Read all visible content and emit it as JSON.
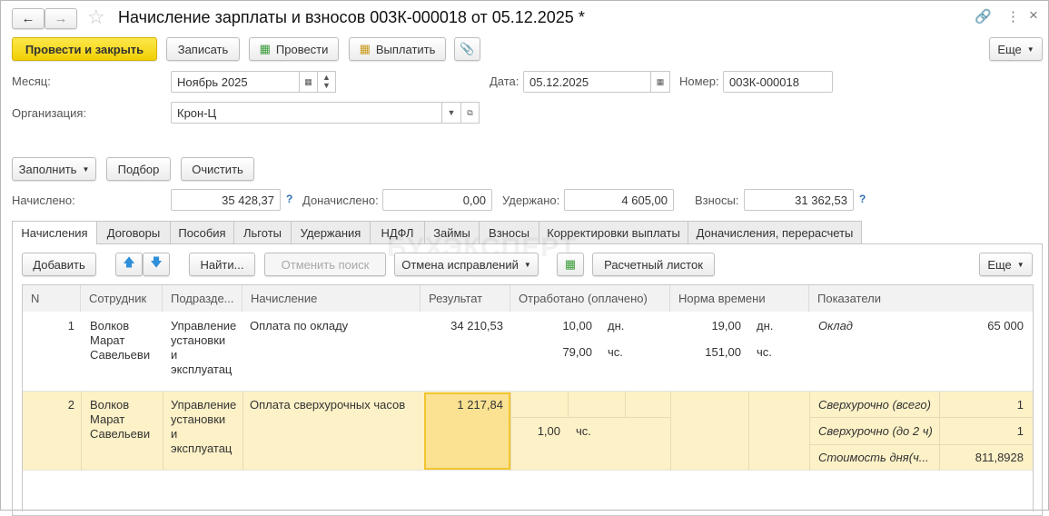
{
  "window": {
    "title": "Начисление зарплаты и взносов 003К-000018 от 05.12.2025 *",
    "icons": [
      "back-arrow-icon",
      "forward-arrow-icon",
      "star-icon",
      "link-icon",
      "more-icon",
      "close-icon"
    ]
  },
  "toolbar": {
    "post_close": "Провести и закрыть",
    "save": "Записать",
    "post": "Провести",
    "pay": "Выплатить",
    "more": "Еще"
  },
  "form": {
    "month_label": "Месяц:",
    "month_value": "Ноябрь 2025",
    "date_label": "Дата:",
    "date_value": "05.12.2025",
    "number_label": "Номер:",
    "number_value": "003К-000018",
    "org_label": "Организация:",
    "org_value": "Крон-Ц"
  },
  "actions": {
    "fill": "Заполнить",
    "select": "Подбор",
    "clear": "Очистить"
  },
  "totals": {
    "accrued_label": "Начислено:",
    "accrued": "35 428,37",
    "extra_label": "Доначислено:",
    "extra": "0,00",
    "withheld_label": "Удержано:",
    "withheld": "4 605,00",
    "contrib_label": "Взносы:",
    "contrib": "31 362,53",
    "help": "?"
  },
  "tabs": [
    "Начисления",
    "Договоры",
    "Пособия",
    "Льготы",
    "Удержания",
    "НДФЛ",
    "Займы",
    "Взносы",
    "Корректировки выплаты",
    "Доначисления, перерасчеты"
  ],
  "watermark": "БУХЭКСПЕРТ",
  "table_toolbar": {
    "add": "Добавить",
    "find": "Найти...",
    "cancel_search": "Отменить поиск",
    "cancel_corrections": "Отмена исправлений",
    "payslip": "Расчетный листок",
    "more": "Еще"
  },
  "table": {
    "columns": [
      "N",
      "Сотрудник",
      "Подразде...",
      "Начисление",
      "Результат",
      "Отработано (оплачено)",
      "Норма времени",
      "Показатели"
    ],
    "rows": [
      {
        "n": "1",
        "employee": [
          "Волков",
          "Марат",
          "Савельеви"
        ],
        "dept": [
          "Управление",
          "установки",
          "и",
          "эксплуатац"
        ],
        "accrual": "Оплата по окладу",
        "result": "34 210,53",
        "worked": [
          {
            "v": "10,00",
            "u": "дн."
          },
          {
            "v": "79,00",
            "u": "чс."
          }
        ],
        "norm": [
          {
            "v": "19,00",
            "u": "дн."
          },
          {
            "v": "151,00",
            "u": "чс."
          }
        ],
        "indicators": [
          {
            "name": "Оклад",
            "value": "65 000"
          }
        ]
      },
      {
        "n": "2",
        "employee": [
          "Волков",
          "Марат",
          "Савельеви"
        ],
        "dept": [
          "Управление",
          "установки",
          "и",
          "эксплуатац"
        ],
        "accrual": "Оплата сверхурочных часов",
        "result": "1 217,84",
        "worked": [
          {
            "v": "1,00",
            "u": "чс."
          }
        ],
        "indicators": [
          {
            "name": "Сверхурочно (всего)",
            "value": "1"
          },
          {
            "name": "Сверхурочно (до 2 ч)",
            "value": "1"
          },
          {
            "name": "Стоимость дня(ч...",
            "value": "811,8928"
          }
        ]
      }
    ]
  },
  "colors": {
    "accent_yellow": "#f5d20a",
    "row_selected": "#fdf1c7",
    "cell_active": "#fbe292"
  }
}
